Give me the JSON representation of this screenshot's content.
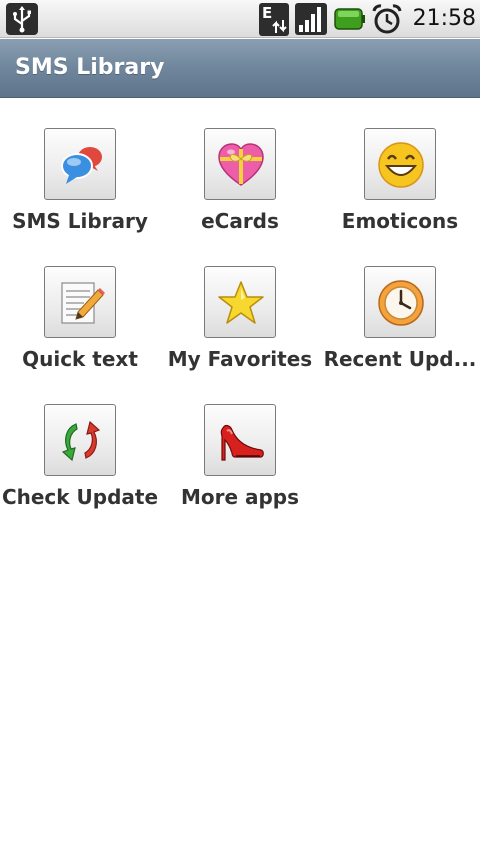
{
  "status_bar": {
    "time": "21:58",
    "network_label": "E",
    "icons": [
      "usb-icon",
      "data-network-icon",
      "signal-icon",
      "battery-icon",
      "alarm-icon"
    ]
  },
  "title_bar": {
    "title": "SMS Library"
  },
  "menu": {
    "items": [
      {
        "label": "SMS Library",
        "icon": "speech-bubbles-icon"
      },
      {
        "label": "eCards",
        "icon": "gift-heart-icon"
      },
      {
        "label": "Emoticons",
        "icon": "smiley-icon"
      },
      {
        "label": "Quick text",
        "icon": "notepad-pencil-icon"
      },
      {
        "label": "My Favorites",
        "icon": "star-icon"
      },
      {
        "label": "Recent Upd...",
        "icon": "clock-icon"
      },
      {
        "label": "Check Update",
        "icon": "refresh-arrows-icon"
      },
      {
        "label": "More apps",
        "icon": "high-heel-icon"
      }
    ]
  },
  "colors": {
    "title_bar": "#6f869c",
    "label_text": "#333333",
    "background": "#ffffff"
  }
}
